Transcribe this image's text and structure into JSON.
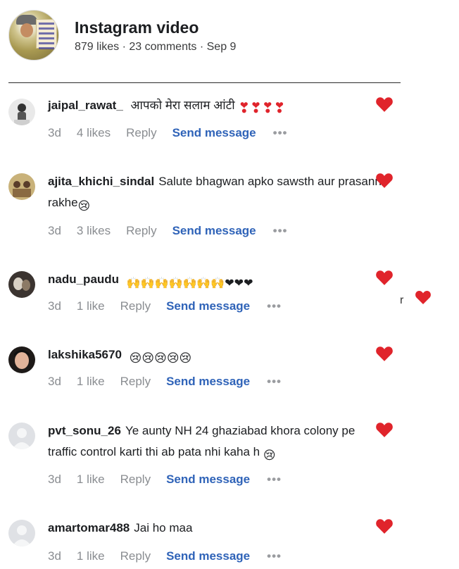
{
  "post": {
    "title": "Instagram video",
    "meta": "879 likes · 23 comments · Sep 9"
  },
  "colors": {
    "heart": "#e0242b",
    "link": "#2f63b8",
    "muted": "#8a8d91"
  },
  "comments": [
    {
      "username": "jaipal_rawat_",
      "text": "आपको मेरा सलाम आंटी",
      "emoji": "❣❣❣❣",
      "time": "3d",
      "likes": "4 likes",
      "reply": "Reply",
      "send": "Send message",
      "more": "•••"
    },
    {
      "username": "ajita_khichi_sindal",
      "text": "Salute bhagwan apko sawsth aur prasann rakhe",
      "emoji": "😢",
      "time": "3d",
      "likes": "3 likes",
      "reply": "Reply",
      "send": "Send message",
      "more": "•••"
    },
    {
      "username": "nadu_paudu",
      "text": "",
      "emoji": "🙌🙌🙌🙌🙌🙌🙌❤❤❤",
      "time": "3d",
      "likes": "1 like",
      "reply": "Reply",
      "send": "Send message",
      "more": "•••"
    },
    {
      "username": "lakshika5670",
      "text": "",
      "emoji": "😢😢😢😢😢",
      "time": "3d",
      "likes": "1 like",
      "reply": "Reply",
      "send": "Send message",
      "more": "•••"
    },
    {
      "username": "pvt_sonu_26",
      "text": "Ye aunty NH 24 ghaziabad khora colony pe traffic control karti thi ab pata nhi kaha h",
      "emoji": "😢",
      "time": "3d",
      "likes": "1 like",
      "reply": "Reply",
      "send": "Send message",
      "more": "•••"
    },
    {
      "username": "amartomar488",
      "text": "Jai ho maa",
      "emoji": "",
      "time": "3d",
      "likes": "1 like",
      "reply": "Reply",
      "send": "Send message",
      "more": "•••"
    }
  ],
  "stray_char": "r"
}
